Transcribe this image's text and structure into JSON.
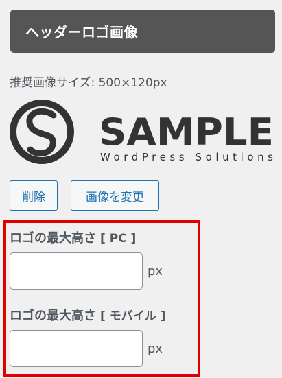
{
  "section": {
    "title": "ヘッダーロゴ画像"
  },
  "recommended_size": "推奨画像サイズ: 500×120px",
  "logo": {
    "main_text": "SAMPLE",
    "sub_text": "WordPress Solutions"
  },
  "buttons": {
    "remove_label": "削除",
    "change_label": "画像を変更"
  },
  "fields": {
    "pc": {
      "label": "ロゴの最大高さ",
      "suffix": "[ PC ]",
      "value": "",
      "unit": "px"
    },
    "mobile": {
      "label": "ロゴの最大高さ",
      "suffix": "[ モバイル ]",
      "value": "",
      "unit": "px"
    }
  },
  "colors": {
    "header_bg": "#555555",
    "button_accent": "#2271b1",
    "highlight_border": "#e00000",
    "logo_color": "#333333"
  }
}
